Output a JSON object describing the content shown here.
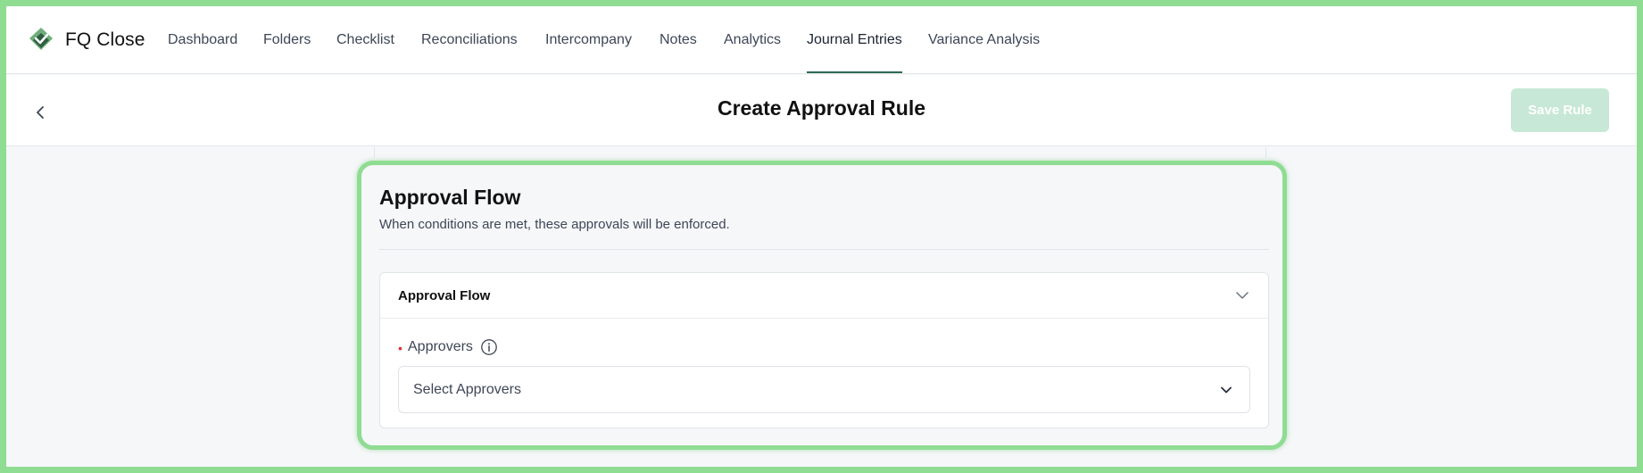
{
  "app": {
    "brand": "FQ Close"
  },
  "nav": {
    "items": [
      {
        "label": "Dashboard"
      },
      {
        "label": "Folders"
      },
      {
        "label": "Checklist"
      },
      {
        "label": "Reconciliations"
      },
      {
        "label": "Intercompany"
      },
      {
        "label": "Notes"
      },
      {
        "label": "Analytics"
      },
      {
        "label": "Journal Entries",
        "active": true
      },
      {
        "label": "Variance Analysis"
      }
    ]
  },
  "header": {
    "title": "Create Approval Rule",
    "save_label": "Save Rule",
    "save_enabled": false
  },
  "section": {
    "title": "Approval Flow",
    "subtitle": "When conditions are met, these approvals will be enforced.",
    "panel": {
      "title": "Approval Flow",
      "field_label": "Approvers",
      "required": true,
      "select_placeholder": "Select Approvers"
    }
  },
  "colors": {
    "accent": "#2b6a53",
    "highlight": "#8fdc93",
    "save_disabled_bg": "#c7e8d6"
  },
  "icons": {
    "logo": "fq-close-logo-icon",
    "back": "chevron-left-icon",
    "panel_toggle": "chevron-down-icon",
    "info": "info-icon",
    "select": "chevron-down-icon"
  }
}
